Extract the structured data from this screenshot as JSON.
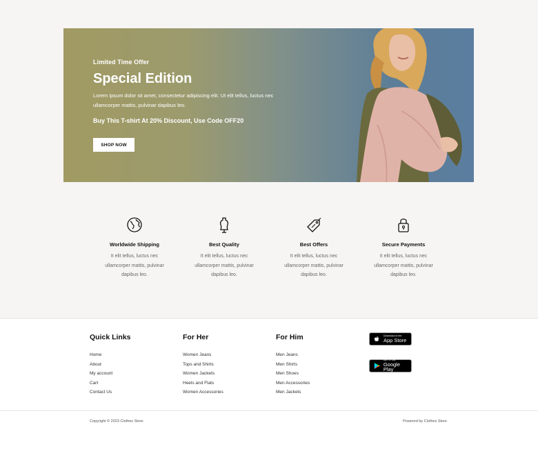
{
  "banner": {
    "eyebrow": "Limited Time Offer",
    "title": "Special Edition",
    "text": "Lorem ipsum dolor sit amet, consectetur adipiscing elit. Ut elit tellus, luctus nec ullamcorper mattis, pulvinar dapibus leo.",
    "promo": "Buy This T-shirt At 20% Discount, Use Code OFF20",
    "button_label": "SHOP NOW"
  },
  "features": [
    {
      "icon": "globe-icon",
      "title": "Worldwide Shipping",
      "text": "It elit tellus, luctus nec ullamcorper mattis, pulvinar dapibus leo."
    },
    {
      "icon": "mannequin-icon",
      "title": "Best Quality",
      "text": "It elit tellus, luctus nec ullamcorper mattis, pulvinar dapibus leo."
    },
    {
      "icon": "price-tag-icon",
      "title": "Best Offers",
      "text": "It elit tellus, luctus nec ullamcorper mattis, pulvinar dapibus leo."
    },
    {
      "icon": "lock-icon",
      "title": "Secure Payments",
      "text": "It elit tellus, luctus nec ullamcorper mattis, pulvinar dapibus leo."
    }
  ],
  "footer": {
    "quick_links": {
      "title": "Quick Links",
      "items": [
        "Home",
        "About",
        "My account",
        "Cart",
        "Contact Us"
      ]
    },
    "for_her": {
      "title": "For Her",
      "items": [
        "Women Jeans",
        "Tops and Shirts",
        "Women Jackets",
        "Heels and Flats",
        "Women Accessories"
      ]
    },
    "for_him": {
      "title": "For Him",
      "items": [
        "Men Jeans",
        "Men Shirts",
        "Men Shoes",
        "Men Accessories",
        "Men Jackets"
      ]
    },
    "app_store": {
      "small": "Download on the",
      "big": "App Store"
    },
    "google_play": {
      "small": "GET IT ON",
      "big": "Google Play"
    },
    "copyright": "Copyright © 2023 Clothes Store",
    "powered": "Powered by Clothes Store"
  }
}
